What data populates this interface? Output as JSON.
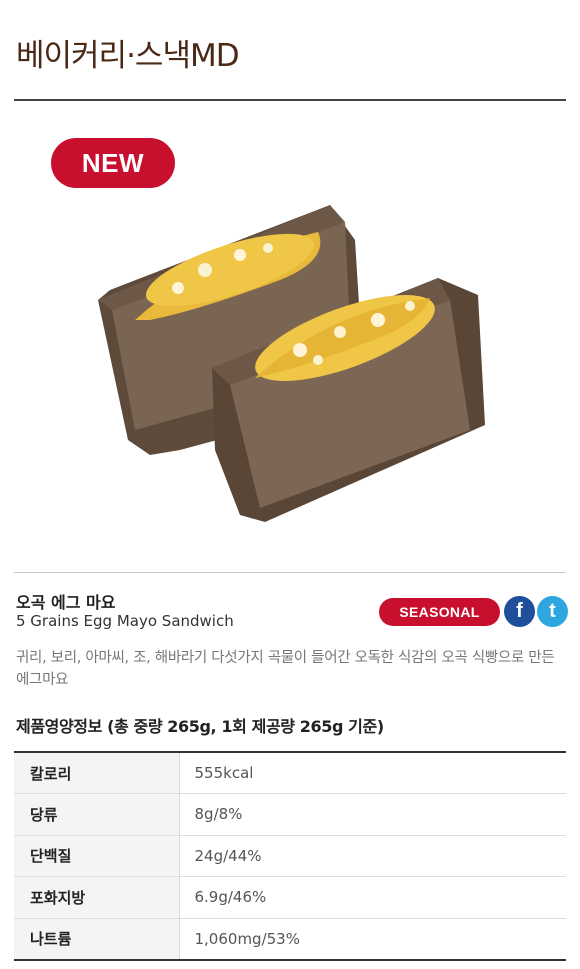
{
  "header": {
    "category_title": "베이커리·스낵MD"
  },
  "badges": {
    "new": "NEW",
    "seasonal": "SEASONAL"
  },
  "product": {
    "name_ko": "오곡 에그 마요",
    "name_en": "5 Grains Egg Mayo Sandwich",
    "description": "귀리, 보리, 아마씨, 조, 해바라기 다섯가지 곡물이 들어간 오독한 식감의 오곡 식빵으로 만든 에그마요",
    "image_icon": "sandwich-image"
  },
  "share": {
    "facebook_glyph": "f",
    "twitter_glyph": "t"
  },
  "nutrition": {
    "title": "제품영양정보 (총 중량 265g, 1회 제공량 265g 기준)",
    "rows": [
      {
        "label": "칼로리",
        "value": "555kcal"
      },
      {
        "label": "당류",
        "value": "8g/8%"
      },
      {
        "label": "단백질",
        "value": "24g/44%"
      },
      {
        "label": "포화지방",
        "value": "6.9g/46%"
      },
      {
        "label": "나트륨",
        "value": "1,060mg/53%"
      }
    ]
  },
  "colors": {
    "brand_red": "#c8102e",
    "title_brown": "#4a2a17",
    "facebook": "#1f4e9a",
    "twitter": "#2ea7e0"
  }
}
